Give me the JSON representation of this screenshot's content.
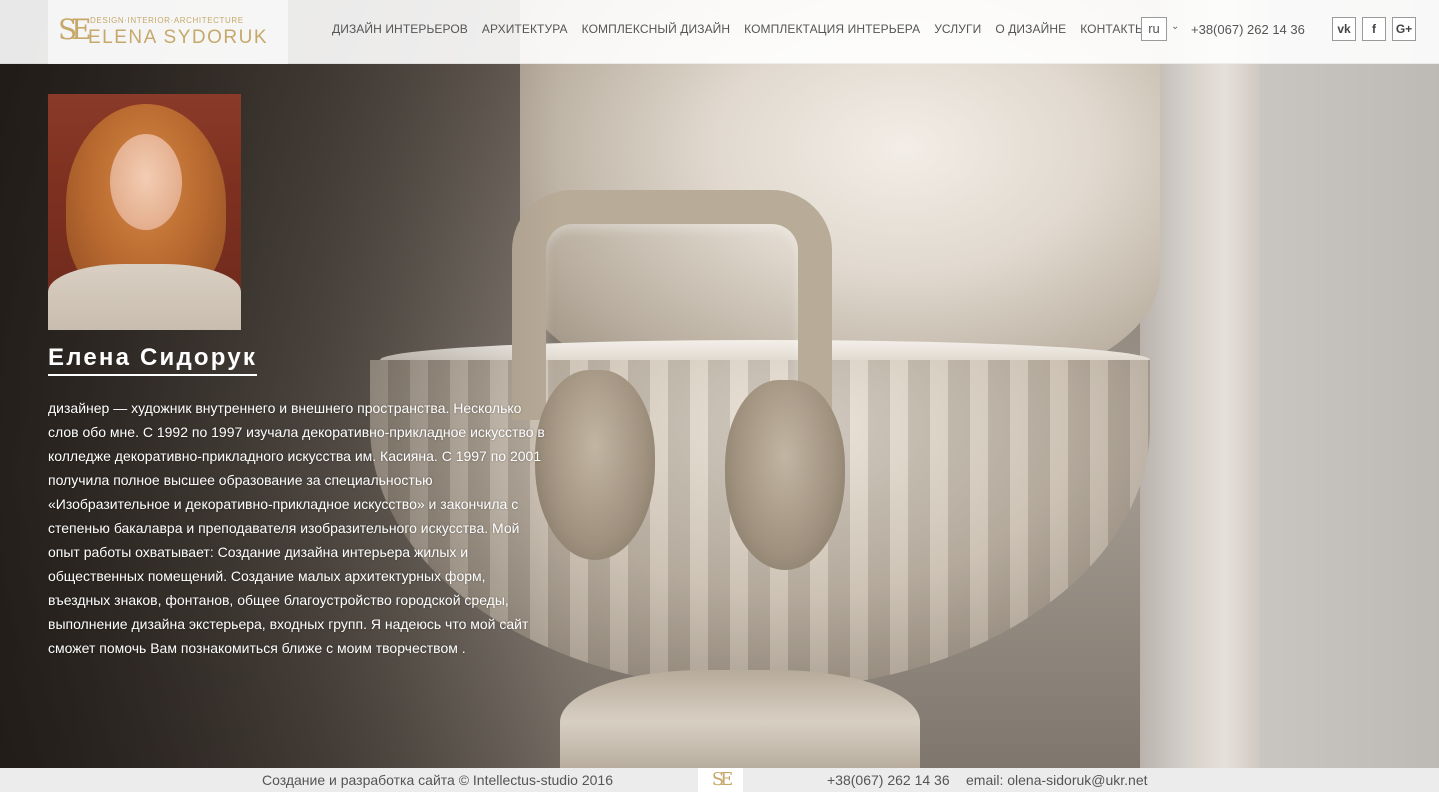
{
  "header": {
    "logo": {
      "mark": "SE",
      "tagline": "DESIGN·INTERIOR·ARCHITECTURE",
      "name": "ELENA SYDORUK"
    },
    "nav": [
      {
        "label": "Дизайн интерьеров"
      },
      {
        "label": "Архитектура"
      },
      {
        "label": "Комплексный дизайн"
      },
      {
        "label": "Комплектация интерьера"
      },
      {
        "label": "Услуги"
      },
      {
        "label": "О дизайне"
      },
      {
        "label": "Контакты"
      }
    ],
    "language": "ru",
    "phone": "+38(067) 262 14 36",
    "social": [
      {
        "label": "vk",
        "icon": "vk-icon"
      },
      {
        "label": "f",
        "icon": "facebook-icon"
      },
      {
        "label": "G+",
        "icon": "google-plus-icon"
      }
    ]
  },
  "profile": {
    "name": "Елена Сидорук",
    "bio": "дизайнер — художник внутреннего и внешнего пространства. Несколько слов обо мне. С 1992 по 1997 изучала декоративно-прикладное искусство в колледже декоративно-прикладного искусства им. Касияна. С 1997 по 2001 получила полное высшее образование за специальностью «Изобразительное и декоративно-прикладное искусство» и закончила с степенью бакалавра и преподавателя изобразительного искусства. Мой опыт работы охватывает: Создание дизайна интерьера жилых и общественных помещений. Создание малых архитектурных форм, въездных знаков, фонтанов, общее благоустройство городской среды, выполнение дизайна экстерьера, входных групп. Я надеюсь что мой сайт сможет помочь Вам познакомиться ближе с моим творчеством ."
  },
  "footer": {
    "copyright": "Создание и разработка сайта © Intellectus-studio 2016",
    "logo_mark": "SE",
    "phone": "+38(067) 262 14 36",
    "email": "email: olena-sidoruk@ukr.net"
  },
  "colors": {
    "accent_gold": "#c7a86b",
    "nav_text": "#555555"
  }
}
